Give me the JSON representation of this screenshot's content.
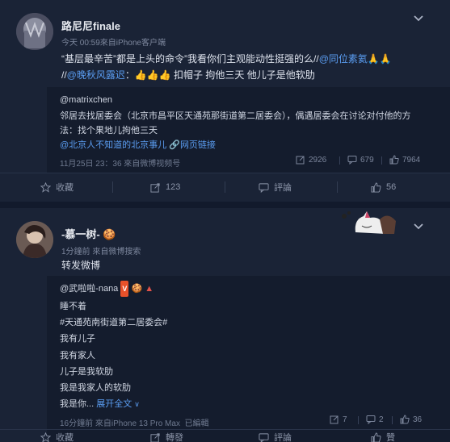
{
  "post1": {
    "username": "路尼尼finale",
    "meta": "今天 00:59來自iPhone客户端",
    "line1_a": "“基层最辛苦”",
    "line1_b": "都是上头的命令",
    "line1_c": "”我看你们主观能动性挺强的么//",
    "mention1": "@同位素氦",
    "line2_prefix": "//",
    "mention2": "@晚秋风露迟",
    "line2_rest": "扣帽子 拘他三天 他儿子是他软肋",
    "repost": {
      "author": "@matrixchen",
      "line1": "邻居去找居委会（北京市昌平区天通苑那街道第二居委会），偶遇居委会在讨论对付他的方",
      "line2": "法：找个果地儿拘他三天",
      "tag": "@北京人不知道的北京事儿",
      "weblink": "网页链接",
      "time": "11月25日 23：36 來自微博视频号",
      "reposts": "2926",
      "comments": "679",
      "likes": "7964"
    },
    "actions": {
      "fav": "收藏",
      "repost": "123",
      "comment": "評論",
      "like": "56"
    }
  },
  "post2": {
    "username": "-慕一树-",
    "meta": "1分鐘前 來自微博搜索",
    "text": "转发微博",
    "repost": {
      "author": "@武啦啦-nana",
      "lines": [
        "睡不着",
        "#天通苑南街道第二居委会#",
        "我有儿子",
        "我有家人",
        "儿子是我软肋",
        "我是我家人的软肋",
        "我是你..."
      ],
      "expand": "展开全文",
      "time": "16分鐘前 來自iPhone 13 Pro Max",
      "edited": "已編輯",
      "reposts": "7",
      "comments": "2",
      "likes": "36"
    },
    "actions": {
      "fav": "收藏",
      "repost": "轉發",
      "comment": "評論",
      "like": "贊"
    }
  },
  "colors": {
    "background": "#121a2c",
    "card": "#1a2336",
    "link": "#5a9cf0",
    "hashtag": "#5a9cf0",
    "meta": "#7c869c"
  }
}
